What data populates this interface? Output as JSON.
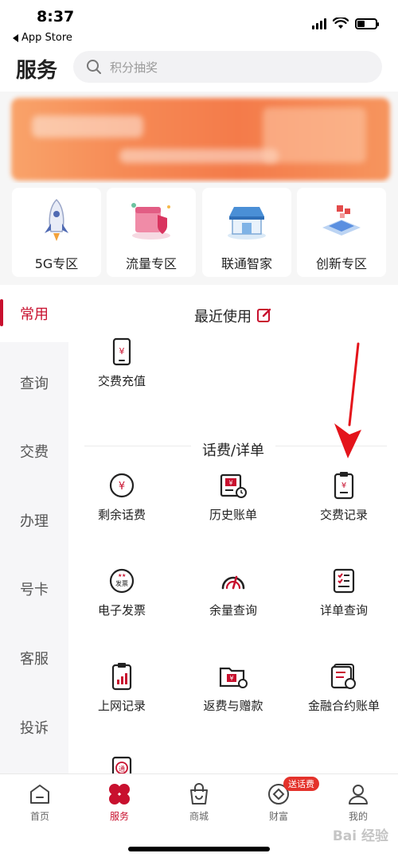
{
  "status_bar": {
    "time": "8:37",
    "back_label": "App Store"
  },
  "header": {
    "title": "服务",
    "search_placeholder": "积分抽奖"
  },
  "quick_entries": [
    {
      "label": "5G专区",
      "icon": "rocket-icon"
    },
    {
      "label": "流量专区",
      "icon": "shield-box-icon"
    },
    {
      "label": "联通智家",
      "icon": "store-icon"
    },
    {
      "label": "创新专区",
      "icon": "laptop-icon"
    }
  ],
  "sidebar": {
    "items": [
      {
        "label": "常用",
        "active": true
      },
      {
        "label": "查询",
        "active": false
      },
      {
        "label": "交费",
        "active": false
      },
      {
        "label": "办理",
        "active": false
      },
      {
        "label": "号卡",
        "active": false
      },
      {
        "label": "客服",
        "active": false
      },
      {
        "label": "投诉",
        "active": false
      }
    ]
  },
  "recent": {
    "title": "最近使用",
    "items": [
      {
        "label": "交费充值",
        "icon": "phone-yen-icon"
      }
    ]
  },
  "bill_section": {
    "title": "话费/详单",
    "items": [
      {
        "label": "剩余话费",
        "icon": "yen-circle-icon"
      },
      {
        "label": "历史账单",
        "icon": "bill-history-icon"
      },
      {
        "label": "交费记录",
        "icon": "payment-record-icon"
      },
      {
        "label": "电子发票",
        "icon": "e-invoice-icon"
      },
      {
        "label": "余量查询",
        "icon": "gauge-icon"
      },
      {
        "label": "详单查询",
        "icon": "checklist-icon"
      },
      {
        "label": "上网记录",
        "icon": "data-usage-icon"
      },
      {
        "label": "返费与赠款",
        "icon": "refund-folder-icon"
      },
      {
        "label": "金融合约账单",
        "icon": "contract-bill-icon"
      }
    ],
    "invoice_icon_text": "发票",
    "partial_icon_text": "通"
  },
  "tabbar": {
    "items": [
      {
        "label": "首页",
        "icon": "home-icon",
        "active": false
      },
      {
        "label": "服务",
        "icon": "service-clover-icon",
        "active": true
      },
      {
        "label": "商城",
        "icon": "shopping-bag-icon",
        "active": false
      },
      {
        "label": "财富",
        "icon": "wealth-icon",
        "active": false
      },
      {
        "label": "我的",
        "icon": "profile-icon",
        "active": false
      }
    ],
    "badge": "送话费"
  },
  "watermark": "Bai 经验",
  "colors": {
    "accent": "#c8102e",
    "banner": "#f47b4a",
    "sidebar_bg": "#f6f6f8"
  }
}
